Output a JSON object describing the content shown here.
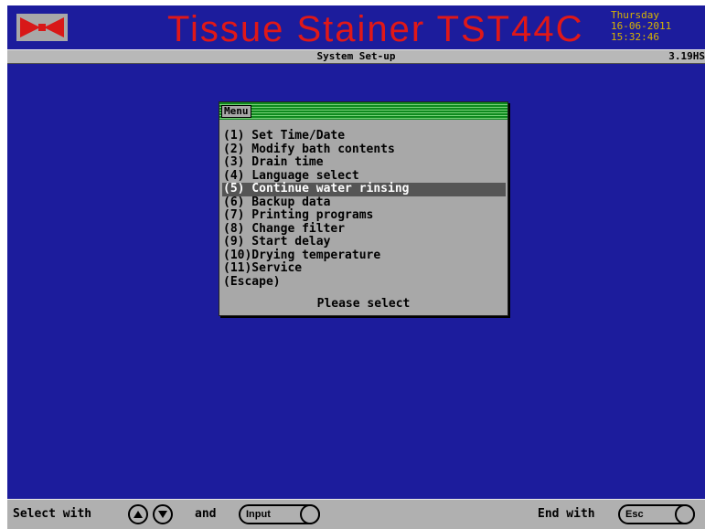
{
  "header": {
    "title": "Tissue Stainer TST44C",
    "day": "Thursday",
    "date": "16-06-2011",
    "time": "15:32:46"
  },
  "subbar": {
    "title": "System Set-up",
    "version": "3.19HS"
  },
  "menu": {
    "label": "Menu",
    "items": [
      "(1) Set Time/Date",
      "(2) Modify bath contents",
      "(3) Drain time",
      "(4) Language select",
      "(5) Continue water rinsing",
      "(6) Backup data",
      "(7) Printing programs",
      "(8) Change filter",
      "(9) Start delay",
      "(10)Drying temperature",
      "(11)Service",
      "(Escape)"
    ],
    "selected_index": 4,
    "prompt": "Please select"
  },
  "footer": {
    "select_with": "Select with",
    "and": "and",
    "input_key": "Input",
    "end_with": "End with",
    "esc_key": "Esc",
    "up_icon": "up-arrow-icon",
    "down_icon": "down-arrow-icon"
  },
  "colors": {
    "background": "#1c1c9c",
    "title": "#e01818",
    "clock": "#d8b400",
    "menu_header": "#0e8a1e",
    "panel": "#a8a8a8"
  }
}
